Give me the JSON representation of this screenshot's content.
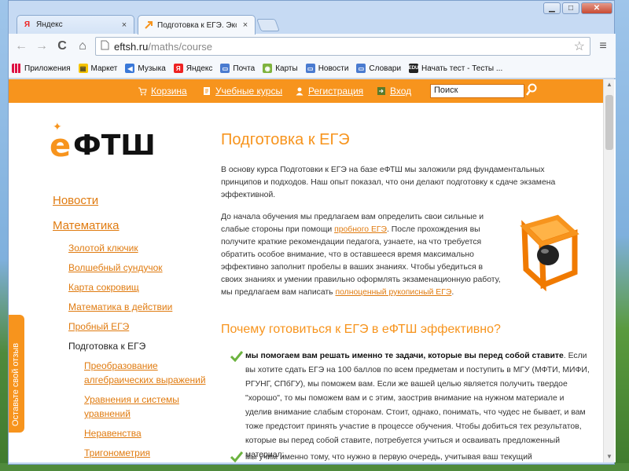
{
  "browser": {
    "tabs": [
      {
        "favicon": "Я",
        "title": "Яндекс",
        "close": "×",
        "active": false
      },
      {
        "favicon": "fav-orange-arrow",
        "title": "Подготовка к ЕГЭ. Экспрес",
        "close": "×",
        "active": true
      }
    ],
    "window_controls": {
      "minimize": "▁",
      "maximize": "□",
      "close": "✕"
    },
    "nav": {
      "back": "←",
      "forward": "→",
      "reload": "C",
      "home": "⌂"
    },
    "url": {
      "host": "eftsh.ru",
      "path": "/maths/course"
    },
    "bookmarks": [
      {
        "icon": "apps-icon",
        "label": "Приложения"
      },
      {
        "icon": "market-icon",
        "label": "Маркет"
      },
      {
        "icon": "music-icon",
        "label": "Музыка"
      },
      {
        "icon": "yandex-icon",
        "label": "Яндекс"
      },
      {
        "icon": "mail-icon",
        "label": "Почта"
      },
      {
        "icon": "maps-icon",
        "label": "Карты"
      },
      {
        "icon": "news-icon",
        "label": "Новости"
      },
      {
        "icon": "dictionary-icon",
        "label": "Словари"
      },
      {
        "icon": "edu-icon",
        "label": "Начать тест - Тесты ..."
      }
    ]
  },
  "site": {
    "topnav": [
      {
        "icon": "cart-icon",
        "label": "Корзина"
      },
      {
        "icon": "courses-icon",
        "label": "Учебные курсы"
      },
      {
        "icon": "user-icon",
        "label": "Регистрация"
      },
      {
        "icon": "login-icon",
        "label": "Вход"
      }
    ],
    "search": {
      "value": "Поиск"
    },
    "logo": {
      "e": "е",
      "text": "ФТШ"
    },
    "feedback_tab": "Оставьте свой отзыв",
    "sidebar": {
      "news": "Новости",
      "math": "Математика",
      "items": [
        "Золотой ключик",
        "Волшебный сундучок",
        "Карта сокровищ",
        "Математика в действии",
        "Пробный ЕГЭ",
        "Подготовка к ЕГЭ"
      ],
      "subitems": [
        {
          "line1": "Преобразование",
          "line2": "алгебраических выражений"
        },
        {
          "line1": "Уравнения и системы",
          "line2": "уравнений"
        },
        {
          "line1": "Неравенства",
          "line2": ""
        },
        {
          "line1": "Тригонометрия",
          "line2": ""
        }
      ]
    },
    "content": {
      "title": "Подготовка к ЕГЭ",
      "intro": "В основу курса Подготовки к ЕГЭ на базе еФТШ мы заложили ряд фундаментальных принципов и подходов. Наш опыт показал, что они делают подготовку к сдаче экзамена эффективной.",
      "p2_before": "До начала обучения мы предлагаем вам определить свои сильные и слабые стороны при помощи ",
      "p2_link1": "пробного ЕГЭ",
      "p2_middle": ". После прохождения вы получите краткие рекомендации педагога, узнаете, на что требуется обратить особое внимание, что в оставшееся время максимально эффективно заполнит пробелы в ваших знаниях. Чтобы убедиться в своих знаниях и умении правильно оформлять экзаменационную работу, мы предлагаем вам написать ",
      "p2_link2": "полноценный рукописный ЕГЭ",
      "p2_after": ".",
      "subtitle": "Почему готовиться к ЕГЭ в еФТШ эффективно?",
      "list1_bold": "мы помогаем вам решать именно те задачи, которые вы перед собой ставите",
      "list1_text": ". Если вы хотите сдать ЕГЭ на 100 баллов по всем предметам и поступить в МГУ (МФТИ, МИФИ, РГУНГ, СПбГУ), мы поможем вам. Если же вашей целью является получить твердое \"хорошо\", то мы поможем вам и с этим, заострив внимание на нужном материале и уделив внимание слабым сторонам. Стоит, однако, понимать, что чудес не бывает, и вам тоже предстоит принять участие в процессе обучения. Чтобы добиться тех результатов, которые вы перед собой ставите, потребуется учиться и осваивать предложенный материал;",
      "list2_text": "мы учим именно тому, что нужно в первую очередь, учитывая ваш текущий"
    }
  },
  "colors": {
    "accent": "#f7941d",
    "link": "#e07b10",
    "check": "#6cb33f"
  }
}
